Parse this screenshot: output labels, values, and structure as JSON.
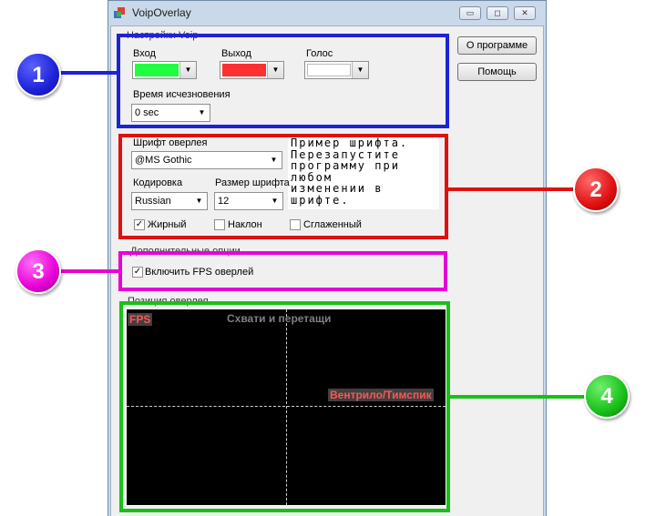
{
  "window": {
    "title": "VoipOverlay",
    "minimize": "▭",
    "maximize": "◻",
    "close": "✕"
  },
  "buttons": {
    "about": "О программе",
    "help": "Помощь"
  },
  "voip_group": {
    "title": "Настройки Voip",
    "input_label": "Вход",
    "input_color": "#20ff40",
    "output_label": "Выход",
    "output_color": "#ff3030",
    "voice_label": "Голос",
    "voice_color": "#ffffff",
    "fade_label": "Время исчезновения",
    "fade_value": "0 sec"
  },
  "font_group": {
    "font_label": "Шрифт оверлея",
    "font_value": "@MS Gothic",
    "encoding_label": "Кодировка",
    "encoding_value": "Russian",
    "size_label": "Размер шрифта",
    "size_value": "12",
    "preview_text": "Пример шрифта.\nПерезапустите\nпрограмму при\nлюбом\nизменении в\nшрифте.",
    "bold_label": "Жирный",
    "bold_checked": true,
    "italic_label": "Наклон",
    "italic_checked": false,
    "smooth_label": "Сглаженный",
    "smooth_checked": false
  },
  "options_group": {
    "title": "Дополнительные опции",
    "fps_label": "Включить FPS оверлей",
    "fps_checked": true
  },
  "position_group": {
    "title": "Позиция оверлея",
    "drag_text": "Схвати и перетащи",
    "fps_tag": "FPS",
    "voip_tag": "Вентрило/Тимспик"
  },
  "callouts": [
    {
      "number": "1",
      "color": "#1e22d8"
    },
    {
      "number": "2",
      "color": "#e01010"
    },
    {
      "number": "3",
      "color": "#e800d8"
    },
    {
      "number": "4",
      "color": "#18c018"
    }
  ],
  "icons": {
    "app": "app-icon",
    "dropdown": "chevron-down-icon",
    "check": "checkmark-icon"
  }
}
